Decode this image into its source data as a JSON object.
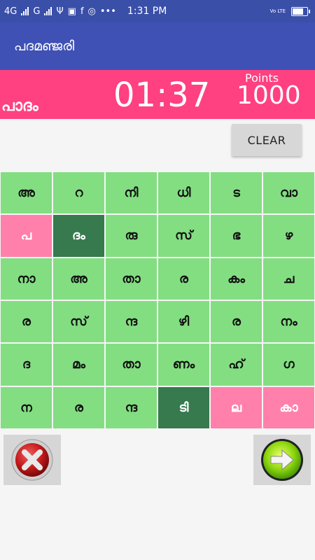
{
  "status_bar": {
    "network_1": "4G",
    "network_2": "G",
    "time": "1:31 PM",
    "volte": "Vo LTE"
  },
  "app_bar": {
    "title": "പദമഞ്ജരി"
  },
  "score": {
    "current_word": "പാദം",
    "timer": "01:37",
    "points_label": "Points",
    "points_value": "1000"
  },
  "clear_button": {
    "label": "CLEAR"
  },
  "grid": [
    [
      "അ",
      "റ",
      "നി",
      "ധി",
      "ട",
      "വാ"
    ],
    [
      "പ",
      "ദം",
      "രു",
      "സ്",
      "ഭ",
      "ഴ"
    ],
    [
      "നാ",
      "അ",
      "താ",
      "ര",
      "കം",
      "ച"
    ],
    [
      "ര",
      "സ്",
      "ന്ദ",
      "ഴി",
      "ര",
      "നം"
    ],
    [
      "ദ",
      "മം",
      "താ",
      "ണം",
      "ഹ്",
      "ഗ"
    ],
    [
      "ന",
      "ര",
      "ന്ദ",
      "ടി",
      "ല",
      "കാ"
    ]
  ],
  "cell_states": [
    [
      "normal",
      "normal",
      "normal",
      "normal",
      "normal",
      "normal"
    ],
    [
      "pink",
      "dark",
      "normal",
      "normal",
      "normal",
      "normal"
    ],
    [
      "normal",
      "normal",
      "normal",
      "normal",
      "normal",
      "normal"
    ],
    [
      "normal",
      "normal",
      "normal",
      "normal",
      "normal",
      "normal"
    ],
    [
      "normal",
      "normal",
      "normal",
      "normal",
      "normal",
      "normal"
    ],
    [
      "normal",
      "normal",
      "normal",
      "dark",
      "pink",
      "pink"
    ]
  ],
  "colors": {
    "status_bar": "#3a4fa8",
    "app_bar": "#3f51b5",
    "score_bar": "#ff4081",
    "cell_normal": "#83de82",
    "cell_pink": "#ff80ab",
    "cell_dark": "#367a4e"
  },
  "icons": {
    "cancel": "cancel-x-icon",
    "next": "next-arrow-icon"
  }
}
